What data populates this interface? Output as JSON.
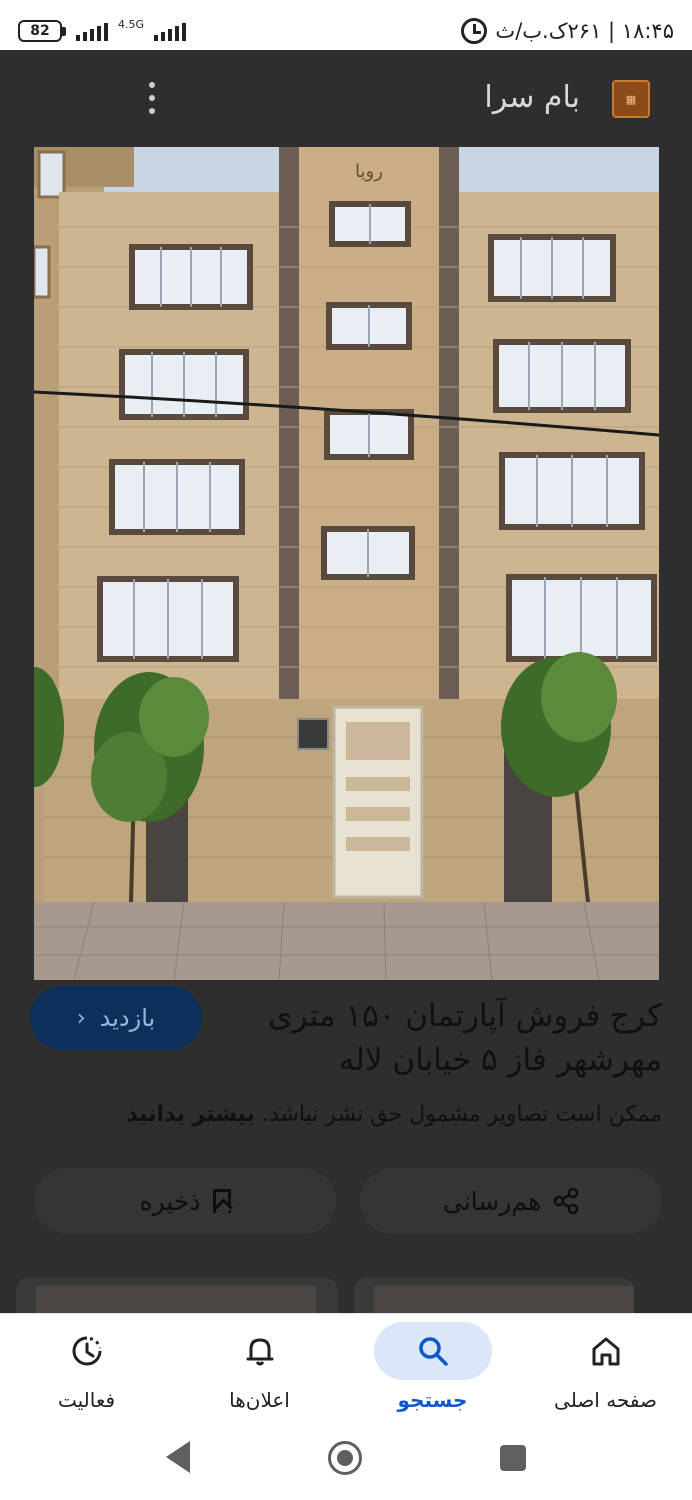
{
  "status_bar": {
    "battery": "82",
    "network": "4.5G",
    "time_info": "۱۸:۴۵ | ۲۶۱ک.ب/ث"
  },
  "source": {
    "title": "بام سرا",
    "logo_icon": "bamsara-logo",
    "menu_icon": "more-vert-icon"
  },
  "image": {
    "sign_text": "رویا"
  },
  "result": {
    "title": "کرج فروش آپارتمان ۱۵۰ متری مهرشهر فاز ۵ خیابان لاله",
    "visit_label": "بازدید",
    "copyright_text": "ممکن است تصاویر مشمول حق نشر نباشد.",
    "learn_more": "بیشتر بدانید",
    "share_label": "هم‌رسانی",
    "save_label": "ذخیره"
  },
  "bottom_nav": {
    "items": [
      {
        "label": "صفحه اصلی",
        "icon": "home-icon"
      },
      {
        "label": "جستجو",
        "icon": "search-icon",
        "active": true
      },
      {
        "label": "اعلان‌ها",
        "icon": "bell-icon"
      },
      {
        "label": "فعالیت",
        "icon": "activity-icon"
      }
    ]
  },
  "colors": {
    "overlay": "#2e2e2e",
    "accent": "#0b57d0",
    "visit_button": "#0c2f5c"
  }
}
